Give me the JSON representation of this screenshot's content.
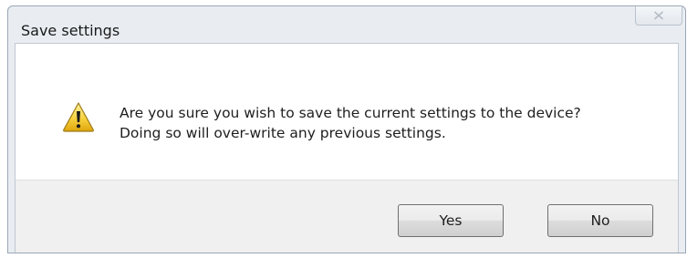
{
  "window": {
    "title": "Save settings",
    "close_icon": "close-icon"
  },
  "dialog": {
    "icon": "warning-icon",
    "message_line1": "Are you sure you wish to save the current settings to the device?",
    "message_line2": "Doing so will over-write any previous settings."
  },
  "buttons": {
    "yes_label": "Yes",
    "no_label": "No"
  }
}
